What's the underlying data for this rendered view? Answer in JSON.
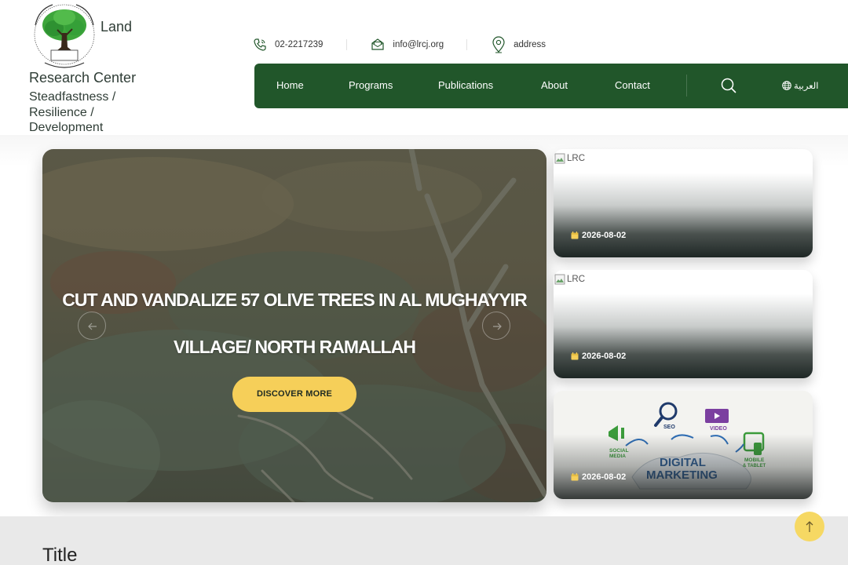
{
  "header": {
    "logo_word": "Land",
    "site_name": "Research Center",
    "tagline": "Steadfastness / Resilience / Development"
  },
  "contact": {
    "phone": "02-2217239",
    "email": "info@lrcj.org",
    "address": "address"
  },
  "nav": {
    "items": [
      "Home",
      "Programs",
      "Publications",
      "About",
      "Contact"
    ],
    "language": "العربية"
  },
  "hero": {
    "title_line1": "CUT AND VANDALIZE 57 OLIVE TREES IN AL MUGHAYYIR",
    "title_line2": "VILLAGE/ NORTH RAMALLAH",
    "button": "DISCOVER MORE"
  },
  "cards": [
    {
      "alt_text": "LRC",
      "date": "2026-08-02"
    },
    {
      "alt_text": "LRC",
      "date": "2026-08-02"
    },
    {
      "image": "digital-marketing-illustration",
      "date": "2026-08-02"
    }
  ],
  "section": {
    "title": "Title"
  },
  "colors": {
    "nav_green": "#21562a",
    "accent_yellow": "#f6cf59"
  },
  "icons": [
    "phone-icon",
    "mail-icon",
    "location-icon",
    "search-icon",
    "globe-icon",
    "calendar-icon",
    "arrow-left-icon",
    "arrow-right-icon",
    "arrow-up-icon",
    "broken-image-icon"
  ]
}
